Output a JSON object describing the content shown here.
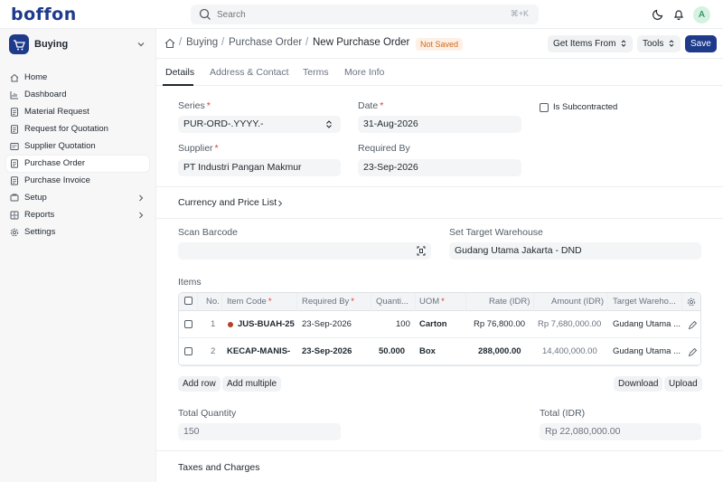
{
  "app": {
    "logo": "boffon"
  },
  "search": {
    "placeholder": "Search",
    "shortcut": "⌘+K"
  },
  "user": {
    "avatar_initial": "A"
  },
  "sidebar": {
    "workspace": "Buying",
    "items": [
      {
        "label": "Home",
        "icon": "home-icon"
      },
      {
        "label": "Dashboard",
        "icon": "chart-icon"
      },
      {
        "label": "Material Request",
        "icon": "file-icon"
      },
      {
        "label": "Request for Quotation",
        "icon": "file-icon"
      },
      {
        "label": "Supplier Quotation",
        "icon": "quote-icon"
      },
      {
        "label": "Purchase Order",
        "icon": "file-icon",
        "active": true
      },
      {
        "label": "Purchase Invoice",
        "icon": "file-icon"
      },
      {
        "label": "Setup",
        "icon": "setup-icon",
        "expandable": true
      },
      {
        "label": "Reports",
        "icon": "grid-icon",
        "expandable": true
      },
      {
        "label": "Settings",
        "icon": "gear-icon"
      }
    ]
  },
  "header": {
    "breadcrumbs": [
      "Buying",
      "Purchase Order"
    ],
    "title": "New Purchase Order",
    "status": "Not Saved",
    "get_items_label": "Get Items From",
    "tools_label": "Tools",
    "save_label": "Save"
  },
  "tabs": [
    "Details",
    "Address & Contact",
    "Terms",
    "More Info"
  ],
  "form": {
    "series_label": "Series",
    "series_value": "PUR-ORD-.YYYY.-",
    "date_label": "Date",
    "date_value": "31-Aug-2026",
    "subcontracted_label": "Is Subcontracted",
    "supplier_label": "Supplier",
    "supplier_value": "PT Industri Pangan Makmur",
    "required_by_label": "Required By",
    "required_by_value": "23-Sep-2026",
    "currency_section": "Currency and Price List",
    "scan_barcode_label": "Scan Barcode",
    "target_warehouse_label": "Set Target Warehouse",
    "target_warehouse_value": "Gudang Utama Jakarta - DND",
    "items_label": "Items",
    "total_qty_label": "Total Quantity",
    "total_qty_value": "150",
    "total_label": "Total (IDR)",
    "total_value": "Rp 22,080,000.00",
    "taxes_section": "Taxes and Charges"
  },
  "items_table": {
    "columns": [
      "No.",
      "Item Code",
      "Required By",
      "Quanti...",
      "UOM",
      "Rate (IDR)",
      "Amount (IDR)",
      "Target Wareho..."
    ],
    "rows": [
      {
        "no": "1",
        "item_code": "JUS-BUAH-25",
        "required_by": "23-Sep-2026",
        "qty": "100",
        "uom": "Carton",
        "rate": "Rp 76,800.00",
        "amount": "Rp 7,680,000.00",
        "warehouse": "Gudang Utama ..."
      },
      {
        "no": "2",
        "item_code": "KECAP-MANIS-",
        "required_by": "23-Sep-2026",
        "qty": "50.000",
        "uom": "Box",
        "rate": "288,000.00",
        "amount": "14,400,000.00",
        "warehouse": "Gudang Utama ..."
      }
    ],
    "add_row_label": "Add row",
    "add_multiple_label": "Add multiple",
    "download_label": "Download",
    "upload_label": "Upload"
  }
}
